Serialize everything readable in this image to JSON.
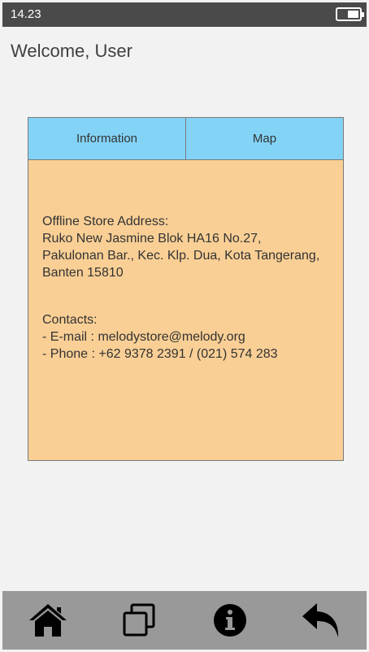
{
  "status_bar": {
    "time": "14.23"
  },
  "header": {
    "welcome": "Welcome, User"
  },
  "tabs": [
    {
      "label": "Information"
    },
    {
      "label": "Map"
    }
  ],
  "info": {
    "address_heading": "Offline Store Address:",
    "address_line1": "Ruko New Jasmine Blok HA16 No.27,",
    "address_line2": "Pakulonan Bar., Kec. Klp. Dua, Kota Tangerang,",
    "address_line3": "Banten 15810",
    "contacts_heading": "Contacts:",
    "email_line": "- E-mail : melodystore@melody.org",
    "phone_line": "- Phone : +62 9378 2391 / (021) 574 283"
  },
  "colors": {
    "status_bar": "#4a4a4a",
    "tab_bg": "#83d3f6",
    "panel_bg": "#f9cf95",
    "bottom_nav": "#999999"
  },
  "nav": {
    "icons": [
      "home-icon",
      "copy-icon",
      "info-icon",
      "back-icon"
    ]
  }
}
